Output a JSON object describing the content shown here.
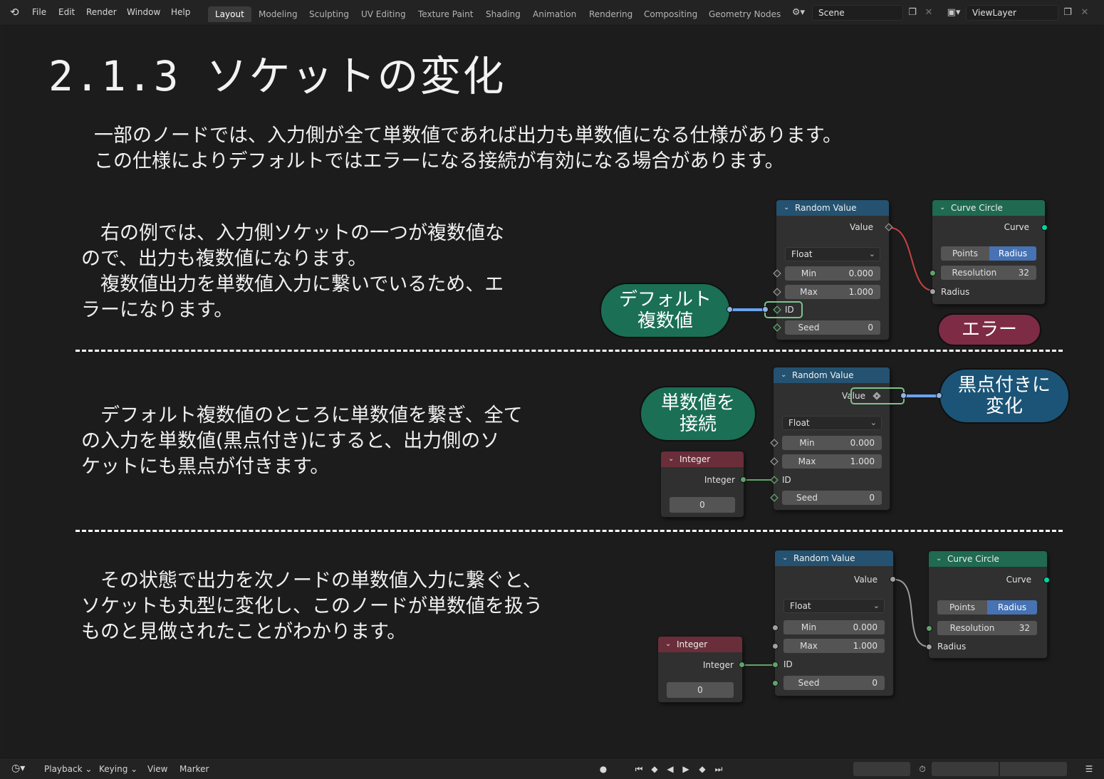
{
  "menu": [
    "File",
    "Edit",
    "Render",
    "Window",
    "Help"
  ],
  "workspaces": [
    "Layout",
    "Modeling",
    "Sculpting",
    "UV Editing",
    "Texture Paint",
    "Shading",
    "Animation",
    "Rendering",
    "Compositing",
    "Geometry Nodes"
  ],
  "scene_name": "Scene",
  "view_layer": "ViewLayer",
  "title": "2.1.3 ソケットの変化",
  "intro": [
    "一部のノードでは、入力側が全て単数値であれば出力も単数値になる仕様があります。",
    "この仕様によりデフォルトではエラーになる接続が有効になる場合があります。"
  ],
  "sections": [
    {
      "text": "　右の例では、入力側ソケットの一つが複数値な\nので、出力も複数値になります。\n　複数値出力を単数値入力に繋いでいるため、エ\nラーになります。",
      "bubbles": [
        "デフォルト\n複数値",
        "エラー"
      ]
    },
    {
      "text": "　デフォルト複数値のところに単数値を繋ぎ、全て\nの入力を単数値(黒点付き)にすると、出力側のソ\nケットにも黒点が付きます。",
      "bubbles": [
        "単数値を\n接続",
        "黒点付きに\n変化"
      ]
    },
    {
      "text": "　その状態で出力を次ノードの単数値入力に繋ぐと、\nソケットも丸型に変化し、このノードが単数値を扱う\nものと見做されたことがわかります。",
      "bubbles": []
    }
  ],
  "random_value": {
    "title": "Random Value",
    "output": "Value",
    "type": "Float",
    "min_label": "Min",
    "min": "0.000",
    "max_label": "Max",
    "max": "1.000",
    "id_label": "ID",
    "seed_label": "Seed",
    "seed": "0"
  },
  "curve_circle": {
    "title": "Curve Circle",
    "output": "Curve",
    "mode_points": "Points",
    "mode_radius": "Radius",
    "resolution_label": "Resolution",
    "resolution": "32",
    "radius_label": "Radius"
  },
  "integer_node": {
    "title": "Integer",
    "output": "Integer",
    "value": "0"
  },
  "timeline": {
    "menus": [
      "Playback",
      "Keying",
      "View",
      "Marker"
    ]
  },
  "colors": {
    "node_blue": "#245270",
    "node_green": "#1f6a50",
    "node_red": "#6a2e3a",
    "bubble_green": "#1a6f55",
    "bubble_blue": "#1b5477",
    "bubble_red": "#7e2b45",
    "error_link": "#c84242",
    "field_link": "#6aa3f0",
    "int_link": "#5fa36a"
  }
}
